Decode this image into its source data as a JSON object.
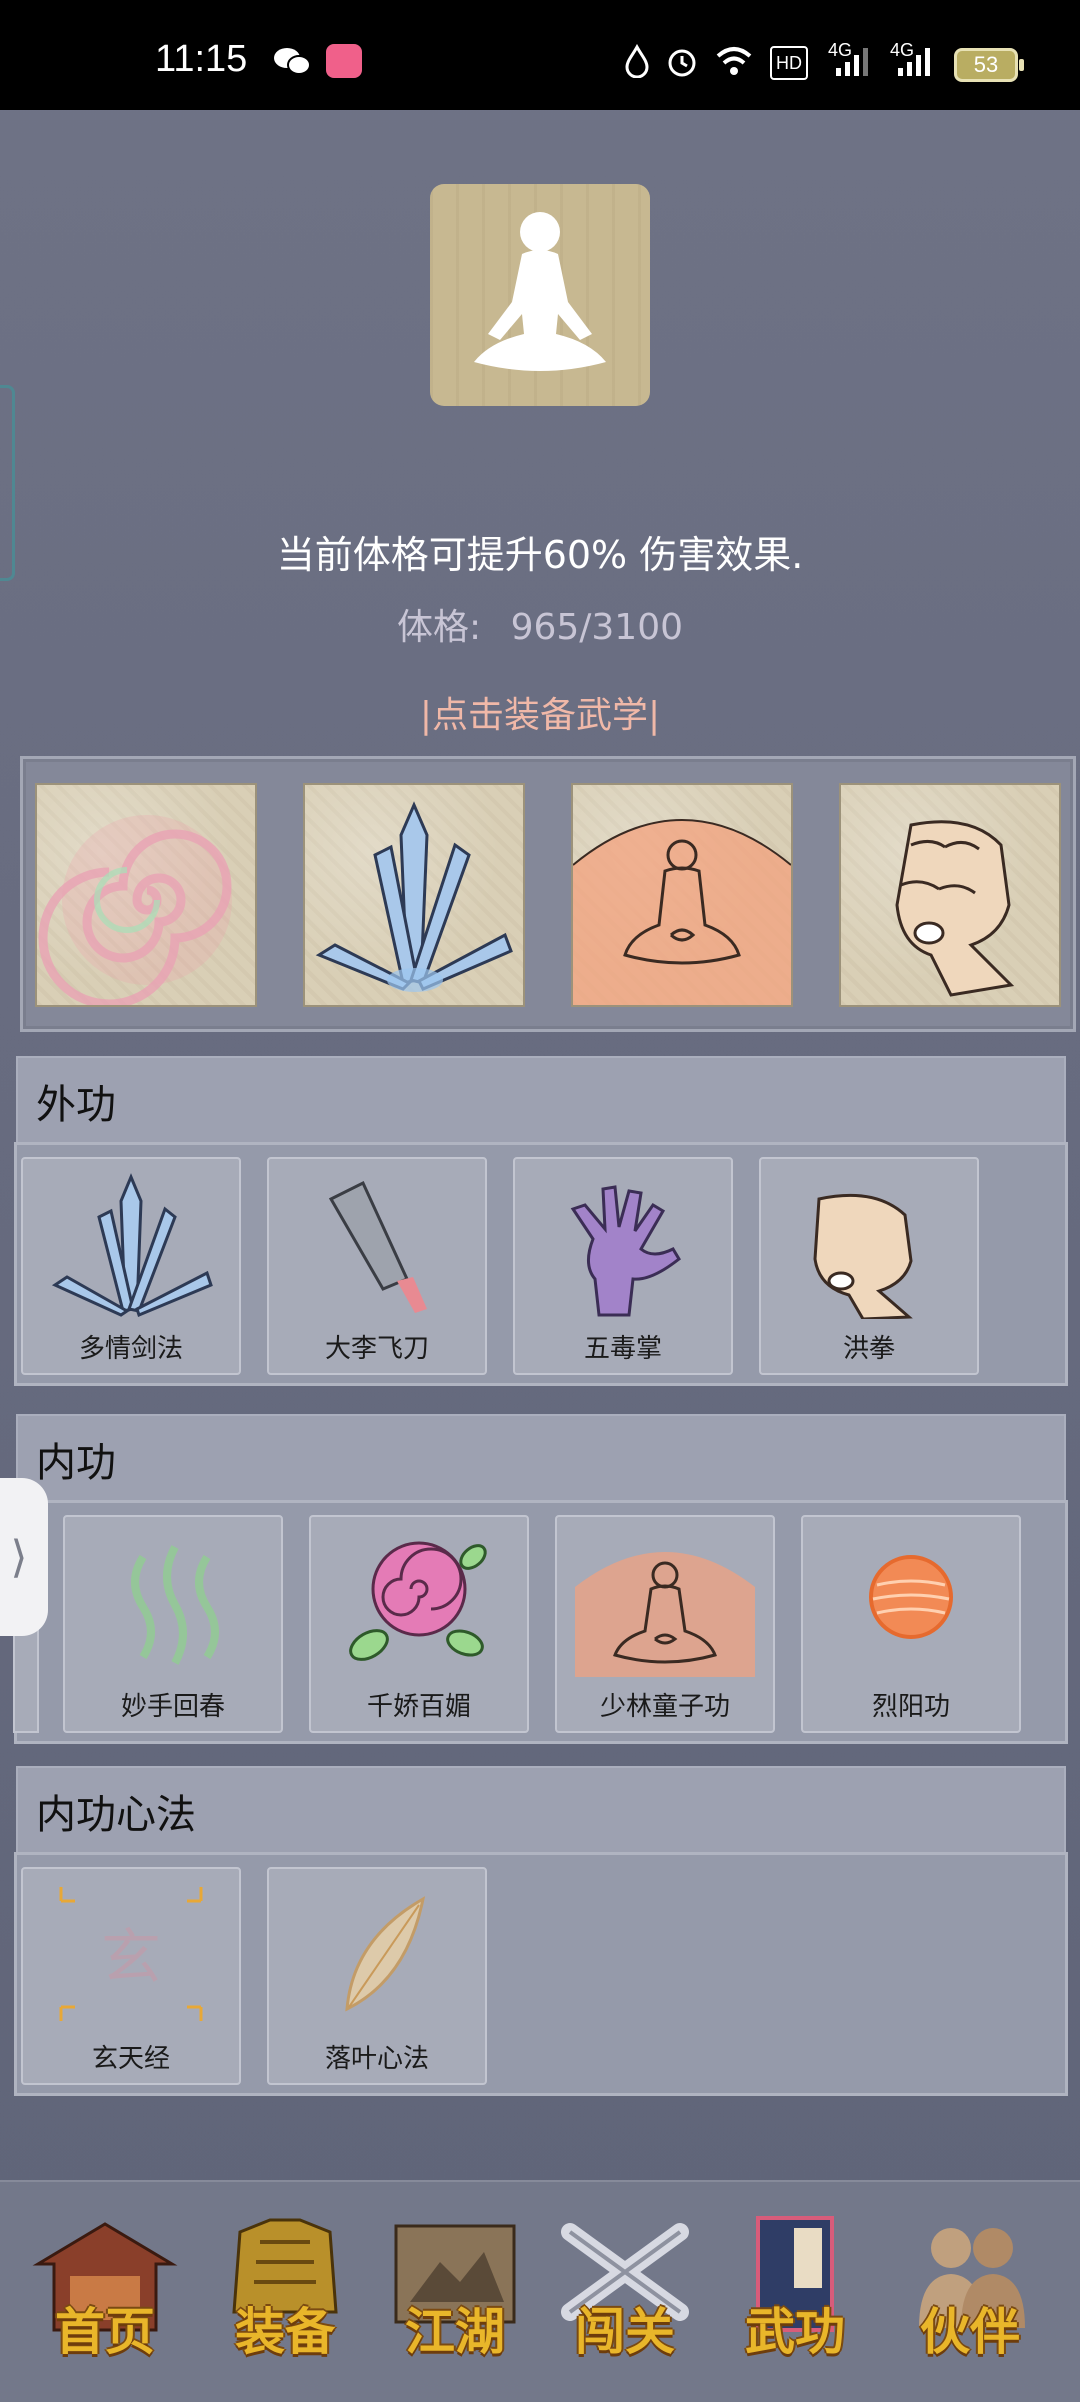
{
  "status_bar": {
    "time": "11:15",
    "hd_label": "HD",
    "net1": "4G",
    "net2": "4G",
    "battery": "53"
  },
  "header": {
    "description": "当前体格可提升60% 伤害效果.",
    "stat_label": "体格:",
    "stat_value": "965/3100",
    "equip_link": "|点击装备武学|"
  },
  "equipped_slots": [
    {
      "icon": "swirl-icon"
    },
    {
      "icon": "sword-fan-icon"
    },
    {
      "icon": "meditating-monk-icon"
    },
    {
      "icon": "fist-icon"
    }
  ],
  "sections": {
    "outer": {
      "title": "外功",
      "items": [
        {
          "label": "多情剑法",
          "icon": "sword-fan-icon"
        },
        {
          "label": "大李飞刀",
          "icon": "cleaver-icon"
        },
        {
          "label": "五毒掌",
          "icon": "purple-palm-icon"
        },
        {
          "label": "洪拳",
          "icon": "fist-icon"
        }
      ]
    },
    "inner": {
      "title": "内功",
      "items": [
        {
          "label": "妙手回春",
          "icon": "green-waves-icon"
        },
        {
          "label": "千娇百媚",
          "icon": "rose-icon"
        },
        {
          "label": "少林童子功",
          "icon": "meditating-monk-icon"
        },
        {
          "label": "烈阳功",
          "icon": "sun-orb-icon"
        }
      ]
    },
    "mind": {
      "title": "内功心法",
      "items": [
        {
          "label": "玄天经",
          "icon": "xuan-glyph-icon",
          "glyph": "玄"
        },
        {
          "label": "落叶心法",
          "icon": "leaf-icon"
        }
      ]
    }
  },
  "bottom_nav": [
    {
      "label": "首页",
      "icon": "pavilion-icon"
    },
    {
      "label": "装备",
      "icon": "armor-icon"
    },
    {
      "label": "江湖",
      "icon": "scroll-map-icon"
    },
    {
      "label": "闯关",
      "icon": "crossed-swords-icon"
    },
    {
      "label": "武功",
      "icon": "martial-book-icon"
    },
    {
      "label": "伙伴",
      "icon": "companions-icon"
    }
  ],
  "colors": {
    "accent_link": "#f0b8a8",
    "nav_gold": "#e9b62a"
  }
}
